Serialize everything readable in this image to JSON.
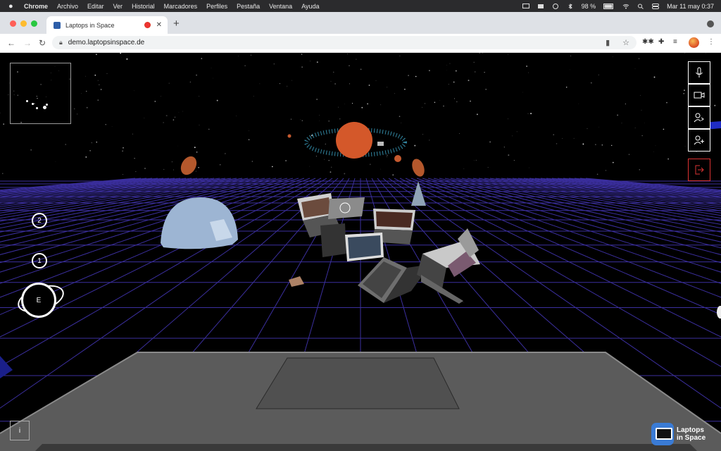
{
  "menubar": {
    "app": "Chrome",
    "items": [
      "Archivo",
      "Editar",
      "Ver",
      "Historial",
      "Marcadores",
      "Perfiles",
      "Pestaña",
      "Ventana",
      "Ayuda"
    ],
    "battery": "98 %",
    "datetime": "Mar 11 may  0:37"
  },
  "browser": {
    "tab_title": "Laptops in Space",
    "url": "demo.laptopsinspace.de",
    "colors": {
      "tabstrip": "#dee1e6",
      "close": "#ff5f57",
      "min": "#febc2e",
      "max": "#28c840"
    }
  },
  "scene": {
    "floor_buttons": [
      "2",
      "1"
    ],
    "earth_button": "E",
    "info_button": "i",
    "logo_line1": "Laptops",
    "logo_line2": "in Space",
    "side_controls": [
      "mic-icon",
      "camera-icon",
      "share-screen-icon",
      "add-user-icon",
      "exit-icon"
    ],
    "colors": {
      "grid": "#3b2f9e",
      "exit": "#d33333",
      "planet": "#d4582a",
      "dome": "#9db5d3"
    }
  }
}
